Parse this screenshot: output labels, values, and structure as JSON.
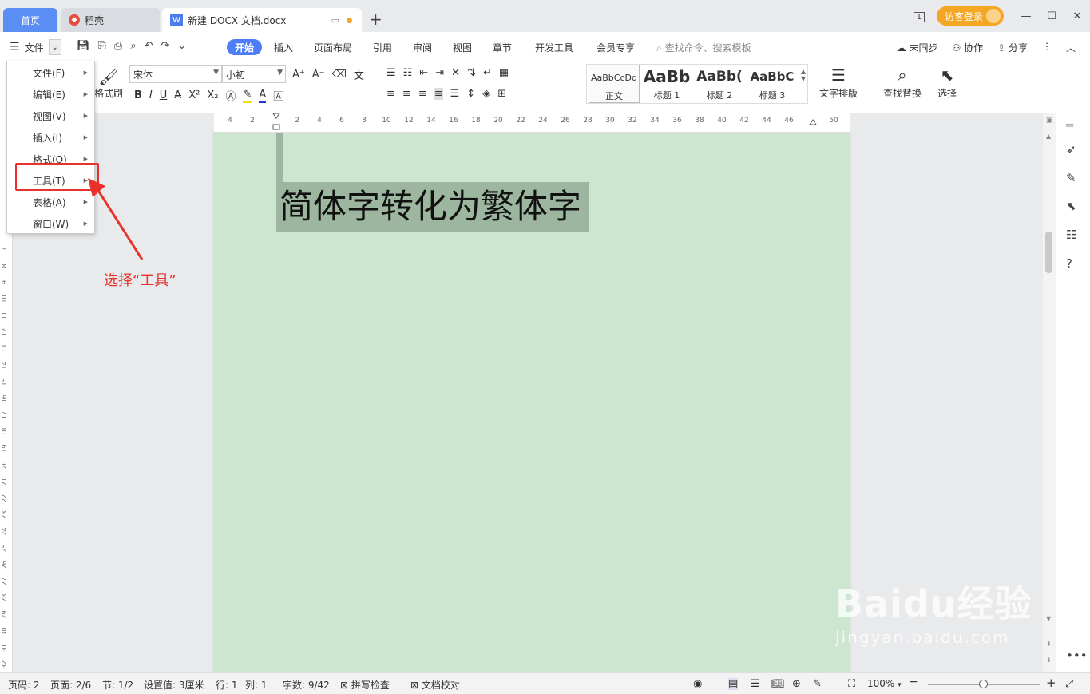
{
  "titlebar": {
    "home_tab": "首页",
    "daoke_tab": "稻壳",
    "doc_tab": "新建 DOCX 文档.docx",
    "login_button": "访客登录",
    "window_badge": "1"
  },
  "menubar": {
    "file_label": "文件",
    "start_tab": "开始",
    "tabs": [
      "插入",
      "页面布局",
      "引用",
      "审阅",
      "视图",
      "章节",
      "开发工具",
      "会员专享"
    ],
    "search_placeholder": "查找命令、搜索模板",
    "unsync": "未同步",
    "collab": "协作",
    "share": "分享"
  },
  "ribbon": {
    "format_brush": "格式刷",
    "font_name": "宋体",
    "font_size": "小初",
    "styles": [
      {
        "preview": "AaBbCcDd",
        "label": "正文"
      },
      {
        "preview": "AaBb",
        "label": "标题 1"
      },
      {
        "preview": "AaBb(",
        "label": "标题 2"
      },
      {
        "preview": "AaBbC",
        "label": "标题 3"
      }
    ],
    "text_layout": "文字排版",
    "find_replace": "查找替换",
    "select": "选择"
  },
  "ruler": {
    "h_ticks": [
      "4",
      "2",
      "2",
      "4",
      "6",
      "8",
      "10",
      "12",
      "14",
      "16",
      "18",
      "20",
      "22",
      "24",
      "26",
      "28",
      "30",
      "32",
      "34",
      "36",
      "38",
      "40",
      "42",
      "44",
      "46",
      "50"
    ],
    "v_ticks": [
      "7",
      "8",
      "9",
      "10",
      "11",
      "12",
      "13",
      "14",
      "15",
      "16",
      "17",
      "18",
      "19",
      "20",
      "21",
      "22",
      "23",
      "24",
      "25",
      "26",
      "27",
      "28",
      "29",
      "30",
      "31",
      "32"
    ]
  },
  "document": {
    "heading": "简体字转化为繁体字"
  },
  "file_menu": {
    "items": [
      "文件(F)",
      "编辑(E)",
      "视图(V)",
      "插入(I)",
      "格式(O)",
      "工具(T)",
      "表格(A)",
      "窗口(W)"
    ]
  },
  "annotation": {
    "text": "选择“工具”",
    "color": "#e8312a"
  },
  "statusbar": {
    "page_code": "页码: 2",
    "page": "页面: 2/6",
    "section": "节: 1/2",
    "setting": "设置值: 3厘米",
    "row": "行: 1",
    "col": "列: 1",
    "word_count": "字数: 9/42",
    "spell_check": "拼写检查",
    "doc_proof": "文档校对",
    "zoom": "100%"
  },
  "watermark": {
    "brand": "Baidu经验",
    "url": "jingyan.baidu.com"
  },
  "colors": {
    "accent": "#4d7ef7",
    "page_bg": "#cde6d0",
    "selection": "#9cb69f",
    "login": "#f5a623"
  }
}
